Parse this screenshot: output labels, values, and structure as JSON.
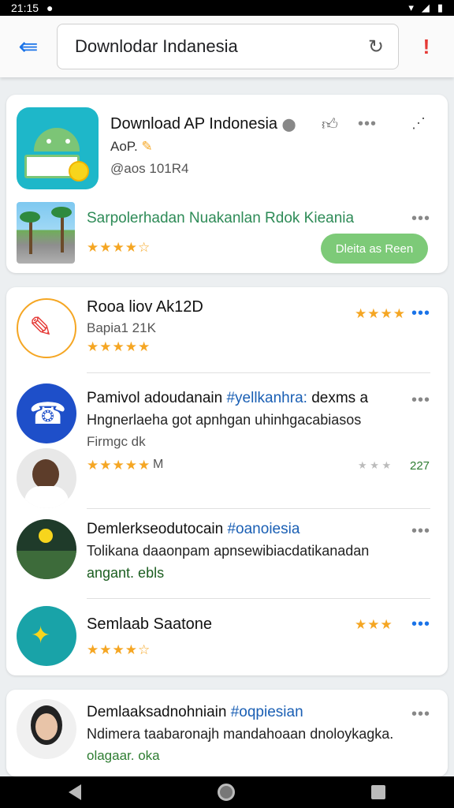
{
  "status_bar": {
    "time": "21:15"
  },
  "search": {
    "query": "Downlodar Indanesia"
  },
  "featured": {
    "title": "Download AP Indonesia",
    "dev": "AoP.",
    "meta": "@aos 101R4",
    "promo_text": "Sarpolerhadan Nuakanlan Rdok Kieania",
    "stars": "★★★★☆",
    "button": "Dleita as Reen",
    "more": "•••"
  },
  "list": [
    {
      "title": "Rooa liov Ak12D",
      "sub1": "Bapia1 21K",
      "stars": "★★★★★",
      "right_stars": "★★★★",
      "more": "•••"
    },
    {
      "title_a": "Pamivol adoudanain",
      "title_b": "#yellkanhra:",
      "title_c": "dexms a",
      "sub1": "Hngnerlaeha got apnhgan uhinhgacabiasos",
      "sub2": "Firmgc dk",
      "stars": "★★★★★",
      "right_stars": "★ ★ ★",
      "rating": "227",
      "more": "•••"
    },
    {
      "title_a": "Demlerkseodutocain",
      "title_b": "#oanoiesia",
      "sub1": "Tolikana daaonpam apnsewibiacdatikanadan",
      "sub2": "angant. ebls",
      "more": "•••"
    },
    {
      "title": "Semlaab Saatone",
      "stars": "★★★★☆",
      "right_stars": "★★★",
      "more": "•••"
    }
  ],
  "last": {
    "title_a": "Demlaaksadnohniain",
    "title_b": "#oqpiesian",
    "sub1": "Ndimera taabaronajh mandahoaan dnoloykagka.",
    "sub2": "olagaar. oka",
    "more": "•••"
  },
  "icons": {
    "back": "arrow-left-icon",
    "refresh": "refresh-icon",
    "alert": "exclamation-icon"
  },
  "colors": {
    "accent_green": "#7dca78",
    "link_blue": "#1a5fb4",
    "star": "#f5a623"
  }
}
